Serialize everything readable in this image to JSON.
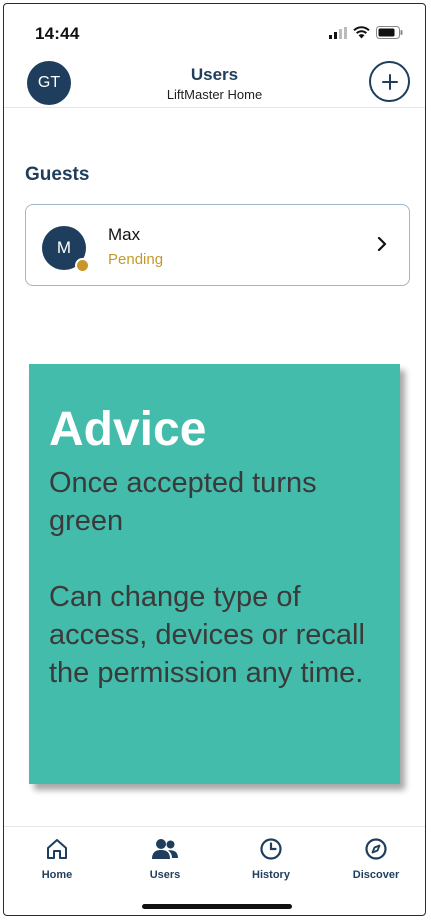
{
  "status_bar": {
    "time": "14:44",
    "icons": [
      "signal-icon",
      "wifi-icon",
      "battery-icon"
    ]
  },
  "header": {
    "avatar_initials": "GT",
    "title": "Users",
    "subtitle": "LiftMaster Home",
    "add_icon": "plus-icon"
  },
  "guests": {
    "section_title": "Guests",
    "items": [
      {
        "initial": "M",
        "name": "Max",
        "status": "Pending",
        "status_color": "#c29a2c"
      }
    ]
  },
  "advice": {
    "title": "Advice",
    "line1": "Once accepted turns green",
    "line2": "Can change type of access, devices or recall the permission any time.",
    "background_color": "#44bcab"
  },
  "nav": {
    "items": [
      {
        "label": "Home",
        "icon": "home-icon"
      },
      {
        "label": "Users",
        "icon": "users-icon",
        "active": true
      },
      {
        "label": "History",
        "icon": "clock-icon"
      },
      {
        "label": "Discover",
        "icon": "compass-icon"
      }
    ]
  },
  "colors": {
    "primary": "#1f3d5c",
    "pending": "#c29a2c",
    "advice": "#44bcab"
  }
}
